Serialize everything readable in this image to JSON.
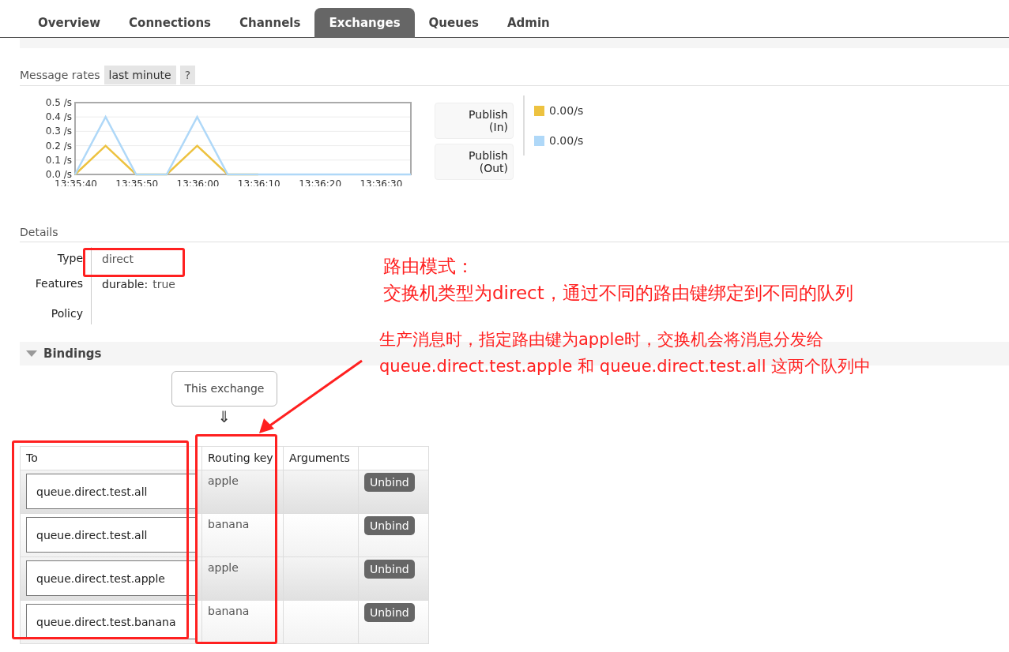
{
  "tabs": [
    {
      "label": "Overview",
      "selected": false
    },
    {
      "label": "Connections",
      "selected": false
    },
    {
      "label": "Channels",
      "selected": false
    },
    {
      "label": "Exchanges",
      "selected": true
    },
    {
      "label": "Queues",
      "selected": false
    },
    {
      "label": "Admin",
      "selected": false
    }
  ],
  "message_rates": {
    "label": "Message rates",
    "range": "last minute",
    "help": "?",
    "chart_data": {
      "type": "line",
      "grid": true,
      "categories": [
        "13:35:40",
        null,
        "13:35:50",
        null,
        "13:36:00",
        null,
        "13:36:10",
        null,
        "13:36:20",
        null,
        "13:36:30",
        null
      ],
      "series": [
        {
          "name": "Publish (In)",
          "color": "#edc240",
          "values": [
            0,
            0.2,
            0,
            0,
            0.2,
            0,
            0,
            null,
            null,
            null,
            null,
            null
          ]
        },
        {
          "name": "Publish (Out)",
          "color": "#afd8f8",
          "values": [
            0,
            0.4,
            0,
            0,
            0.4,
            0,
            0,
            0,
            0,
            0,
            0,
            0
          ]
        }
      ],
      "ylim": [
        0,
        0.5
      ],
      "yticks": [
        {
          "value": 0,
          "label": "0.0 /s"
        },
        {
          "value": 0.1,
          "label": "0.1 /s"
        },
        {
          "value": 0.2,
          "label": "0.2 /s"
        },
        {
          "value": 0.3,
          "label": "0.3 /s"
        },
        {
          "value": 0.4,
          "label": "0.4 /s"
        },
        {
          "value": 0.5,
          "label": "0.5 /s"
        }
      ]
    },
    "legend": [
      {
        "value": "0.00/s"
      },
      {
        "value": "0.00/s"
      }
    ]
  },
  "details": {
    "title": "Details",
    "rows": [
      {
        "label": "Type",
        "value": "direct"
      },
      {
        "label": "Features",
        "key": "durable:",
        "value": "true"
      },
      {
        "label": "Policy"
      }
    ]
  },
  "bindings": {
    "title": "Bindings",
    "expanded": true,
    "source": "This exchange",
    "arrow": "⇓",
    "columns": [
      "To",
      "Routing key",
      "Arguments"
    ],
    "rows": [
      {
        "to": "queue.direct.test.all",
        "routing_key": "apple",
        "button": "Unbind"
      },
      {
        "to": "queue.direct.test.all",
        "routing_key": "banana",
        "button": "Unbind"
      },
      {
        "to": "queue.direct.test.apple",
        "routing_key": "apple",
        "button": "Unbind"
      },
      {
        "to": "queue.direct.test.banana",
        "routing_key": "banana",
        "button": "Unbind"
      }
    ]
  },
  "annotations": {
    "note_1": [
      "路由模式：",
      "交换机类型为direct，通过不同的路由键绑定到不同的队列"
    ],
    "note_2": [
      "生产消息时，指定路由键为apple时，交换机会将消息分发给",
      "queue.direct.test.apple 和 queue.direct.test.all 这两个队列中"
    ]
  }
}
